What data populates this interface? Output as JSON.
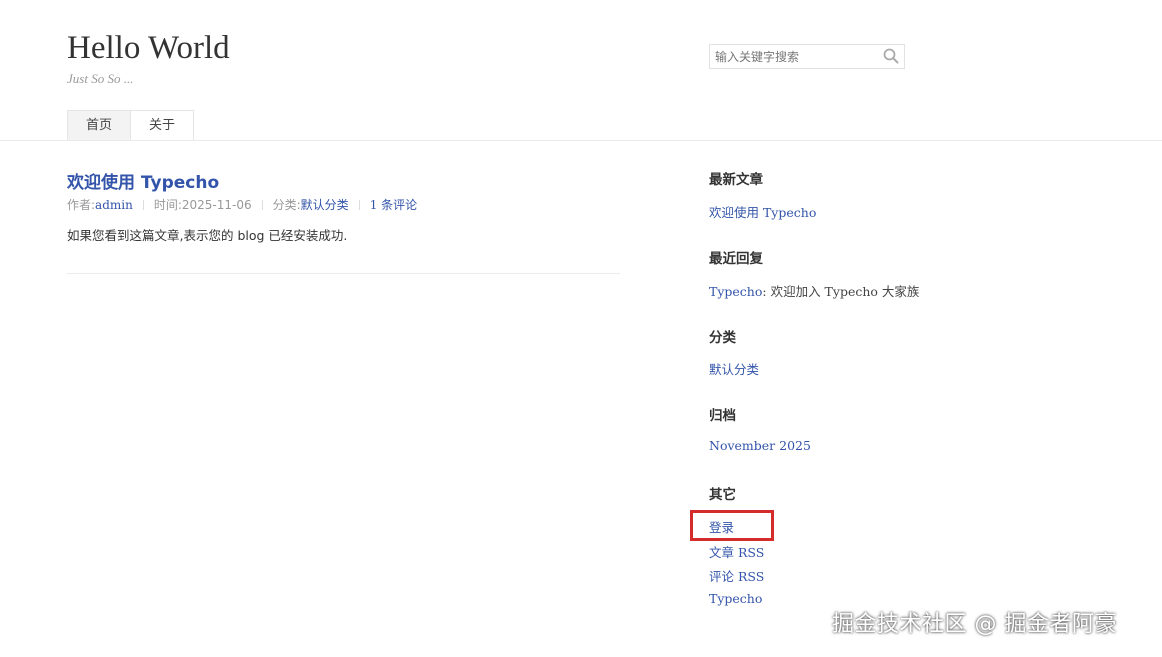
{
  "header": {
    "site_title": "Hello World",
    "site_description": "Just So So ...",
    "search": {
      "placeholder": "输入关键字搜索",
      "value": "",
      "button_icon": "search-icon"
    }
  },
  "nav": {
    "items": [
      {
        "label": "首页",
        "current": true
      },
      {
        "label": "关于",
        "current": false
      }
    ]
  },
  "post": {
    "title": "欢迎使用 Typecho",
    "meta": {
      "author_label": "作者: ",
      "author": "admin",
      "time_label": "时间: ",
      "time": "2025-11-06",
      "category_label": "分类: ",
      "category": "默认分类",
      "comments": "1 条评论"
    },
    "content": "如果您看到这篇文章,表示您的 blog 已经安装成功."
  },
  "sidebar": {
    "recent_posts": {
      "title": "最新文章",
      "items": [
        "欢迎使用 Typecho"
      ]
    },
    "recent_comments": {
      "title": "最近回复",
      "author": "Typecho",
      "text": ": 欢迎加入 Typecho 大家族"
    },
    "categories": {
      "title": "分类",
      "items": [
        "默认分类"
      ]
    },
    "archives": {
      "title": "归档",
      "items": [
        "November 2025"
      ]
    },
    "misc": {
      "title": "其它",
      "items": [
        "登录",
        "文章 RSS",
        "评论 RSS",
        "Typecho"
      ]
    }
  },
  "colors": {
    "link": "#3354aa",
    "highlight": "#d42b2b"
  },
  "watermark": "掘金技术社区 @ 掘金者阿豪"
}
